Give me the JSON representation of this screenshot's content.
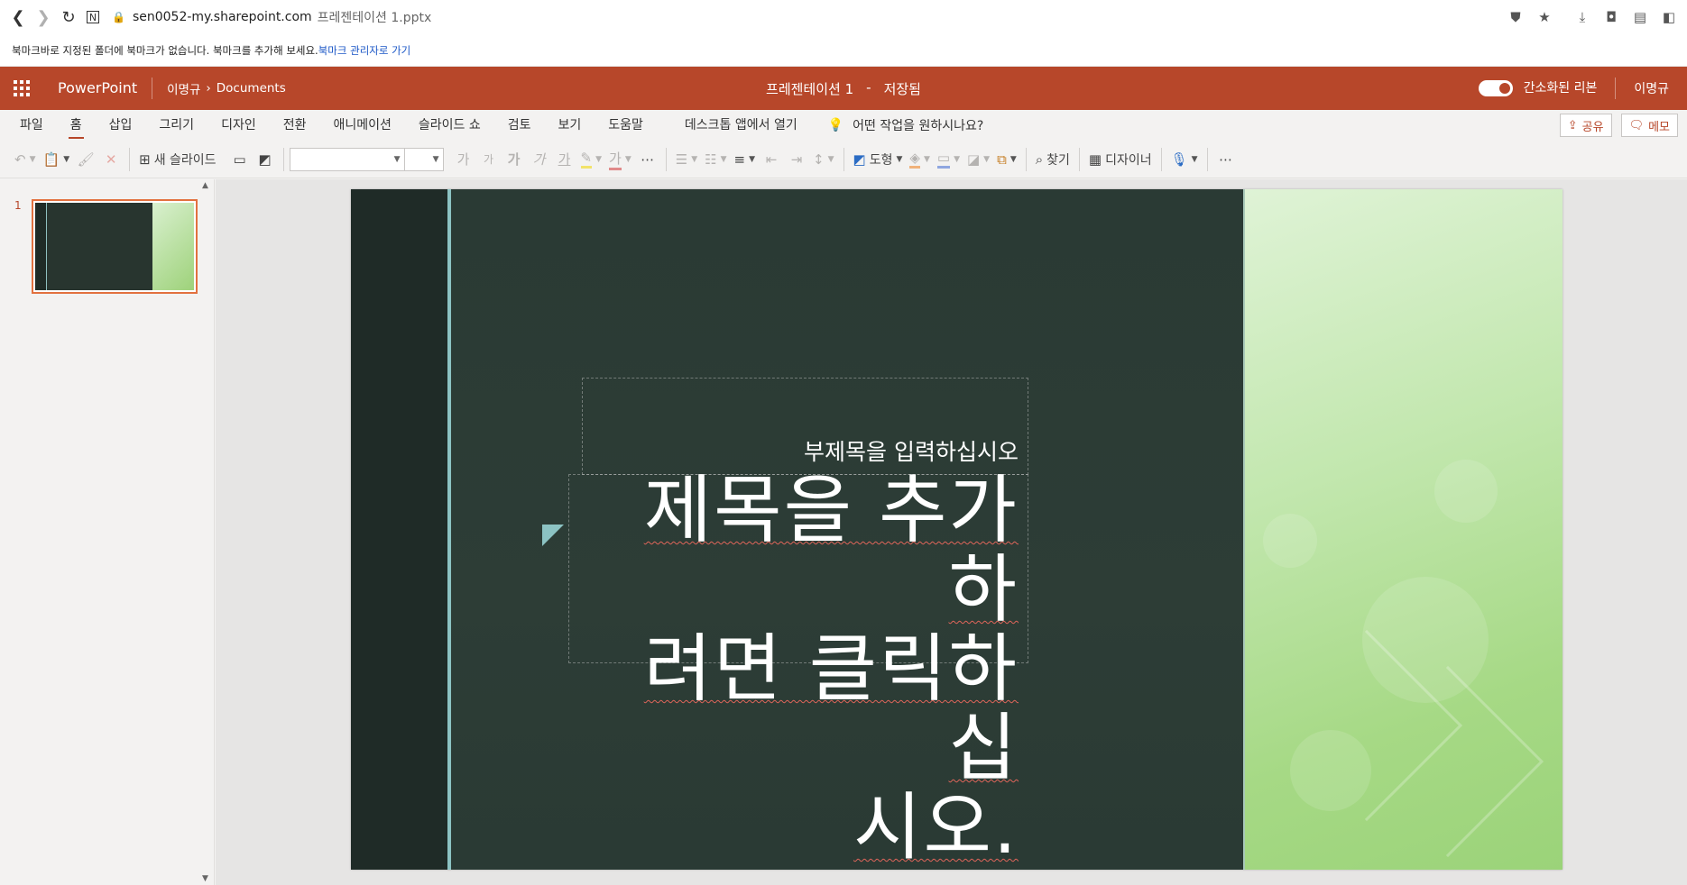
{
  "browser": {
    "url_host": "sen0052-my.sharepoint.com",
    "url_path": "프레젠테이션 1.pptx",
    "bookmark_notice": "북마크바로 지정된 폴더에 북마크가 없습니다. 북마크를 추가해 보세요.",
    "bookmark_link": "북마크 관리자로 가기"
  },
  "header": {
    "app_name": "PowerPoint",
    "crumb_user": "이명규",
    "crumb_sep": "›",
    "crumb_folder": "Documents",
    "doc_title": "프레젠테이션 1",
    "title_dash": "-",
    "save_status": "저장됨",
    "simplified_ribbon_label": "간소화된 리본",
    "user_name": "이명규"
  },
  "tabs": [
    "파일",
    "홈",
    "삽입",
    "그리기",
    "디자인",
    "전환",
    "애니메이션",
    "슬라이드 쇼",
    "검토",
    "보기",
    "도움말"
  ],
  "tabs_extra": {
    "open_desktop": "데스크톱 앱에서 열기",
    "tell_me": "어떤 작업을 원하시나요?",
    "share": "공유",
    "comments": "메모"
  },
  "toolbar": {
    "new_slide": "새 슬라이드",
    "shapes": "도형",
    "find": "찾기",
    "designer": "디자이너",
    "font_glyphs": [
      "가",
      "가",
      "가",
      "가",
      "가",
      "가"
    ]
  },
  "thumbnails": [
    {
      "number": "1"
    }
  ],
  "slide": {
    "subtitle": "부제목을 입력하십시오",
    "title_lines": [
      "제목을 추가하",
      "려면 클릭하십",
      "시오."
    ]
  },
  "colors": {
    "brand": "#b7472a",
    "slide_dark": "#293a33",
    "slide_accent": "#8cc3c3",
    "slide_green": "#a6d985"
  }
}
